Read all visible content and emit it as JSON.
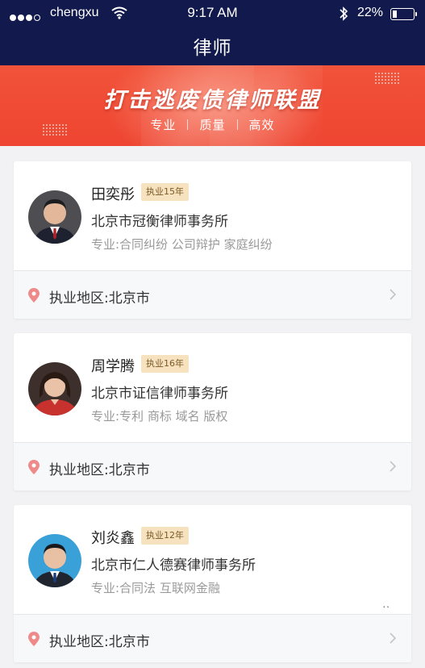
{
  "status_bar": {
    "carrier": "chengxu",
    "time": "9:17 AM",
    "battery": "22%",
    "battery_level": 0.22
  },
  "nav": {
    "title": "律师"
  },
  "banner": {
    "title": "打击逃废债律师联盟",
    "tags": [
      "专业",
      "质量",
      "高效"
    ]
  },
  "lawyers": [
    {
      "name": "田奕彤",
      "badge": "执业15年",
      "firm": "北京市冠衡律师事务所",
      "specialty": "专业:合同纠纷 公司辩护 家庭纠纷",
      "region": "执业地区:北京市"
    },
    {
      "name": "周学腾",
      "badge": "执业16年",
      "firm": "北京市证信律师事务所",
      "specialty": "专业:专利 商标 域名 版权",
      "region": "执业地区:北京市"
    },
    {
      "name": "刘炎鑫",
      "badge": "执业12年",
      "firm": "北京市仁人德赛律师事务所",
      "specialty": "专业:合同法 互联网金融",
      "more": "..",
      "region": "执业地区:北京市"
    }
  ],
  "colors": {
    "header_bg": "#121a4d",
    "banner": "#f04a34",
    "badge_bg": "#f6e2bf",
    "pin": "#ee8a8a"
  },
  "icons": [
    "signal-icon",
    "wifi-icon",
    "bluetooth-icon",
    "battery-icon",
    "location-pin-icon",
    "chevron-right-icon"
  ]
}
